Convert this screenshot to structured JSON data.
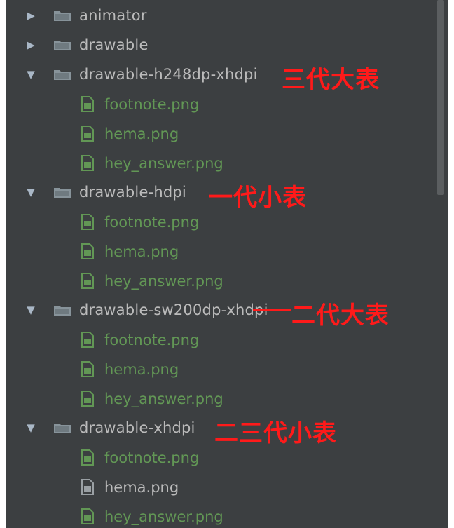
{
  "tree": {
    "items": [
      {
        "type": "folder",
        "label": "animator",
        "expanded": false
      },
      {
        "type": "folder",
        "label": "drawable",
        "expanded": false
      },
      {
        "type": "folder",
        "label": "drawable-h248dp-xhdpi",
        "expanded": true,
        "annotation": "三代大表"
      },
      {
        "type": "file",
        "label": "footnote.png",
        "color": "green"
      },
      {
        "type": "file",
        "label": "hema.png",
        "color": "green"
      },
      {
        "type": "file",
        "label": "hey_answer.png",
        "color": "green"
      },
      {
        "type": "folder",
        "label": "drawable-hdpi",
        "expanded": true,
        "annotation": "一代小表"
      },
      {
        "type": "file",
        "label": "footnote.png",
        "color": "green"
      },
      {
        "type": "file",
        "label": "hema.png",
        "color": "green"
      },
      {
        "type": "file",
        "label": "hey_answer.png",
        "color": "green"
      },
      {
        "type": "folder",
        "label": "drawable-sw200dp-xhdpi",
        "expanded": true,
        "annotation": "二代大表"
      },
      {
        "type": "file",
        "label": "footnote.png",
        "color": "green"
      },
      {
        "type": "file",
        "label": "hema.png",
        "color": "green"
      },
      {
        "type": "file",
        "label": "hey_answer.png",
        "color": "green"
      },
      {
        "type": "folder",
        "label": "drawable-xhdpi",
        "expanded": true,
        "annotation": "二三代小表"
      },
      {
        "type": "file",
        "label": "footnote.png",
        "color": "green"
      },
      {
        "type": "file",
        "label": "hema.png",
        "color": "gray"
      },
      {
        "type": "file",
        "label": "hey_answer.png",
        "color": "green"
      }
    ]
  },
  "colors": {
    "background": "#3c3f41",
    "folder_text": "#bbbbbb",
    "file_green": "#629755",
    "annotation": "#ff1a1a"
  },
  "icons": {
    "collapsed": "triangle-right-icon",
    "expanded": "triangle-down-icon",
    "folder": "folder-icon",
    "file": "image-file-icon"
  }
}
